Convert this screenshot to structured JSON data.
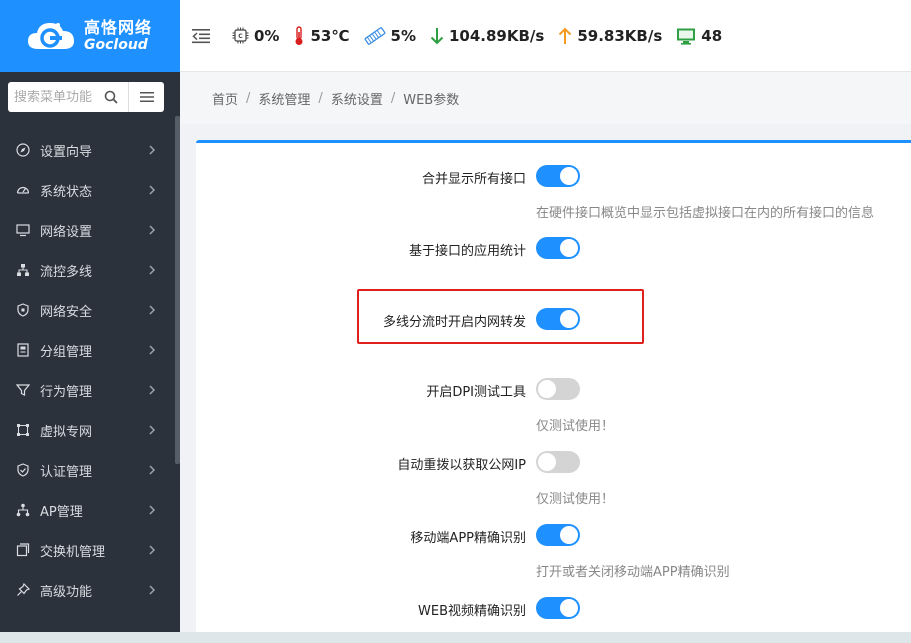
{
  "logo": {
    "cn": "高恪网络",
    "en": "Gocloud"
  },
  "search": {
    "placeholder": "搜索菜单功能"
  },
  "nav": {
    "items": [
      {
        "label": "设置向导",
        "icon": "compass-icon"
      },
      {
        "label": "系统状态",
        "icon": "gauge-icon"
      },
      {
        "label": "网络设置",
        "icon": "monitor-icon"
      },
      {
        "label": "流控多线",
        "icon": "network-tree-icon"
      },
      {
        "label": "网络安全",
        "icon": "shield-icon"
      },
      {
        "label": "分组管理",
        "icon": "group-book-icon"
      },
      {
        "label": "行为管理",
        "icon": "filter-icon"
      },
      {
        "label": "虚拟专网",
        "icon": "vpn-icon"
      },
      {
        "label": "认证管理",
        "icon": "shield-check-icon"
      },
      {
        "label": "AP管理",
        "icon": "ap-tree-icon"
      },
      {
        "label": "交换机管理",
        "icon": "switch-icon"
      },
      {
        "label": "高级功能",
        "icon": "pin-icon"
      }
    ]
  },
  "status": {
    "cpu": "0%",
    "temperature": "53℃",
    "memory": "5%",
    "download": "104.89KB/s",
    "upload": "59.83KB/s",
    "terminals": "48"
  },
  "breadcrumb": {
    "items": [
      "首页",
      "系统管理",
      "系统设置",
      "WEB参数"
    ],
    "separator": "/"
  },
  "settings": [
    {
      "label": "合并显示所有接口",
      "on": true,
      "help": "在硬件接口概览中显示包括虚拟接口在内的所有接口的信息"
    },
    {
      "label": "基于接口的应用统计",
      "on": true,
      "help": ""
    },
    {
      "label": "多线分流时开启内网转发",
      "on": true,
      "help": ""
    },
    {
      "label": "开启DPI测试工具",
      "on": false,
      "help": "仅测试使用！"
    },
    {
      "label": "自动重拨以获取公网IP",
      "on": false,
      "help": "仅测试使用！"
    },
    {
      "label": "移动端APP精确识别",
      "on": true,
      "help": "打开或者关闭移动端APP精确识别"
    },
    {
      "label": "WEB视频精确识别",
      "on": true,
      "help": ""
    }
  ],
  "colors": {
    "accent": "#1e90ff",
    "sidebar": "#2b323c",
    "highlight": "#e0201c"
  }
}
